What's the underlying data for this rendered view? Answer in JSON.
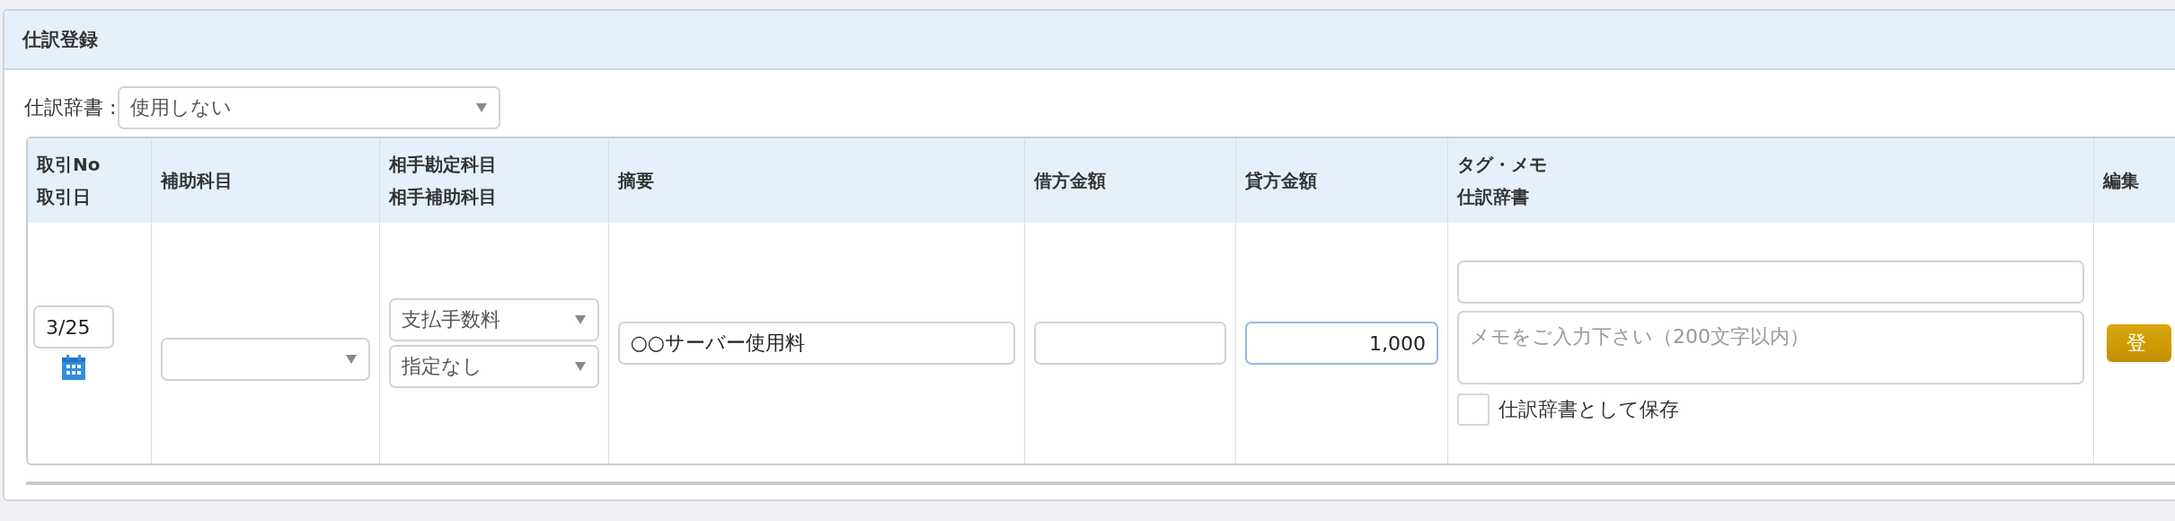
{
  "panel": {
    "title": "仕訳登録"
  },
  "dictionary": {
    "label": "仕訳辞書 :",
    "value": "使用しない"
  },
  "table": {
    "columns": [
      {
        "lines": [
          "取引No",
          "取引日"
        ]
      },
      {
        "lines": [
          "補助科目"
        ]
      },
      {
        "lines": [
          "相手勘定科目",
          "相手補助科目"
        ]
      },
      {
        "lines": [
          "摘要"
        ]
      },
      {
        "lines": [
          "借方金額"
        ]
      },
      {
        "lines": [
          "貸方金額"
        ]
      },
      {
        "lines": [
          "タグ・メモ",
          "仕訳辞書"
        ]
      },
      {
        "lines": [
          "編集"
        ]
      }
    ],
    "row": [
      {
        "kind": "date",
        "value": "3/25"
      },
      {
        "kind": "select"
      },
      {
        "kind": "selects",
        "values": [
          "支払手数料",
          "指定なし"
        ]
      },
      {
        "kind": "text",
        "value": "○○サーバー使用料"
      },
      {
        "kind": "amount",
        "focused": false
      },
      {
        "kind": "amount",
        "value": "1,000",
        "focused": true
      },
      {
        "kind": "memo",
        "placeholder": "メモをご入力下さい（200文字以内）",
        "checkbox": {
          "label": "仕訳辞書として保存",
          "checked": false
        }
      },
      {
        "kind": "button",
        "label": "登"
      }
    ]
  }
}
